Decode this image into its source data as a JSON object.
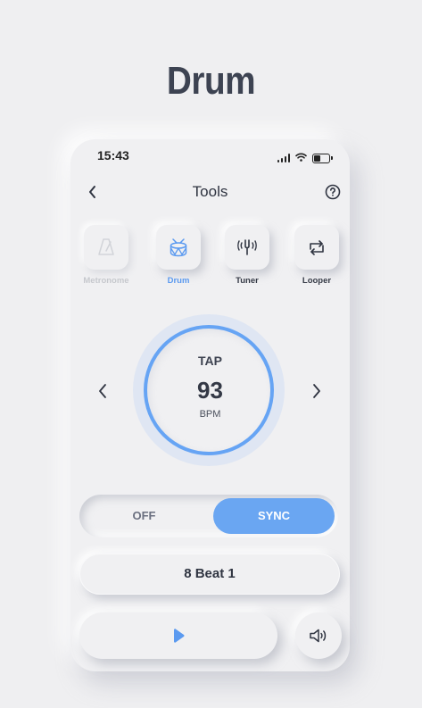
{
  "page": {
    "title": "Drum"
  },
  "status_bar": {
    "time": "15:43",
    "icons": [
      "signal-icon",
      "wifi-icon",
      "battery-icon"
    ]
  },
  "nav": {
    "title": "Tools",
    "back_icon": "chevron-left-icon",
    "help_icon": "help-circle-icon"
  },
  "tools": [
    {
      "label": "Metronome",
      "icon": "metronome-icon",
      "state": "disabled"
    },
    {
      "label": "Drum",
      "icon": "drum-icon",
      "state": "active"
    },
    {
      "label": "Tuner",
      "icon": "tuning-fork-icon",
      "state": "normal"
    },
    {
      "label": "Looper",
      "icon": "loop-icon",
      "state": "normal"
    }
  ],
  "tempo": {
    "tap_label": "TAP",
    "value": "93",
    "unit": "BPM"
  },
  "sync_toggle": {
    "off_label": "OFF",
    "on_label": "SYNC",
    "selected": "SYNC"
  },
  "pattern": {
    "label": "8 Beat 1"
  },
  "controls": {
    "play_icon": "play-icon",
    "sound_icon": "speaker-icon"
  },
  "colors": {
    "accent": "#6aa6f2",
    "ring": "#66a4f4",
    "background": "#efeff1",
    "text_dark": "#2f3441",
    "disabled": "#c6c8cd"
  }
}
